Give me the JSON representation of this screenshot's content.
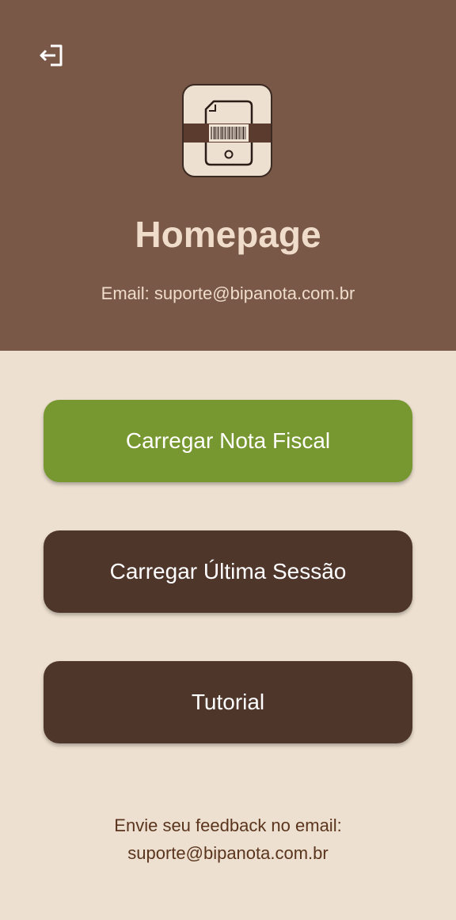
{
  "header": {
    "title": "Homepage",
    "email_text": "Email: suporte@bipanota.com.br",
    "logout_icon": "logout-icon",
    "logo_icon": "document-barcode-phone-icon"
  },
  "actions": {
    "load_invoice": "Carregar Nota Fiscal",
    "load_last_session": "Carregar Última Sessão",
    "tutorial": "Tutorial"
  },
  "footer": {
    "line1": "Envie seu feedback no email:",
    "line2": "suporte@bipanota.com.br"
  },
  "colors": {
    "header_bg": "#795848",
    "page_bg": "#ede0d0",
    "primary_button": "#779830",
    "secondary_button": "#4f362b",
    "footer_text": "#5a341c"
  }
}
